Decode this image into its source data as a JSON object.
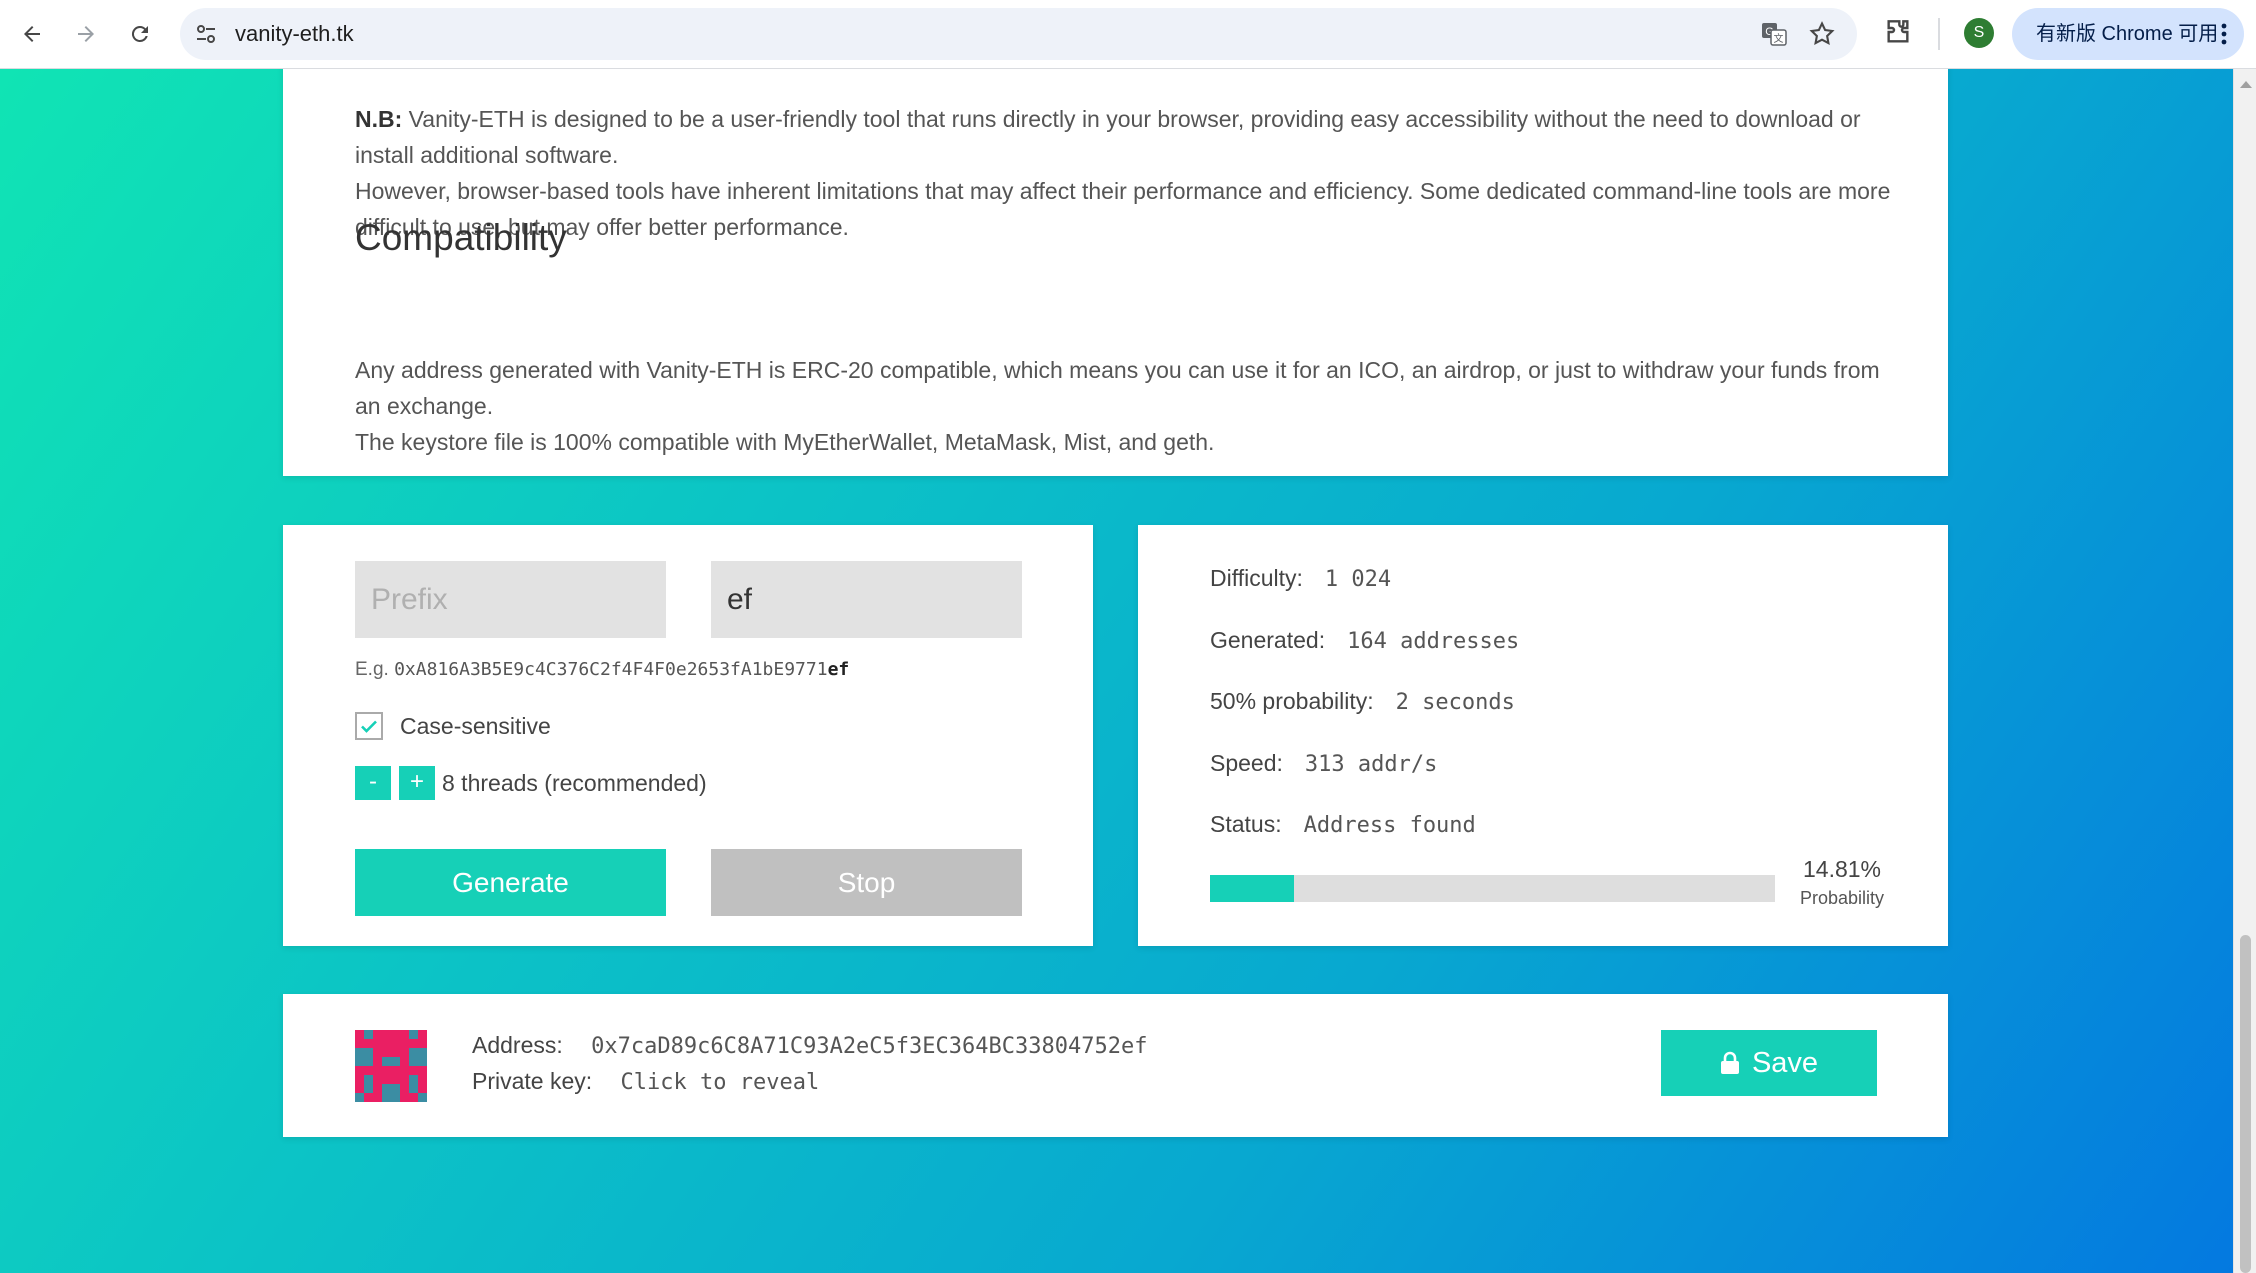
{
  "browser": {
    "url": "vanity-eth.tk",
    "profile_initial": "S",
    "update_label": "有新版 Chrome 可用"
  },
  "info": {
    "nb_bold": "N.B:",
    "nb_text": " Vanity-ETH is designed to be a user-friendly tool that runs directly in your browser, providing easy accessibility without the need to download or install additional software.",
    "limits_text": "However, browser-based tools have inherent limitations that may affect their performance and efficiency. Some dedicated command-line tools are more difficult to use, but may offer better performance.",
    "compat_heading": "Compatibility",
    "compat_text": "Any address generated with Vanity-ETH is ERC-20 compatible, which means you can use it for an ICO, an airdrop, or just to withdraw your funds from an exchange.",
    "keystore_text": "The keystore file is 100% compatible with MyEtherWallet, MetaMask, Mist, and geth."
  },
  "input": {
    "prefix_placeholder": "Prefix",
    "suffix_value": "ef",
    "example_label": "E.g.",
    "example_address": "0xA816A3B5E9c4C376C2f4F4F0e2653fA1bE9771",
    "example_suffix": "ef",
    "case_sensitive_label": "Case-sensitive",
    "case_sensitive_checked": true,
    "minus_label": "-",
    "plus_label": "+",
    "threads_label": "8 threads (recommended)",
    "generate_label": "Generate",
    "stop_label": "Stop"
  },
  "stats": {
    "difficulty_label": "Difficulty:",
    "difficulty_value": "1 024",
    "generated_label": "Generated:",
    "generated_value": "164 addresses",
    "probability50_label": "50% probability:",
    "probability50_value": "2 seconds",
    "speed_label": "Speed:",
    "speed_value": "313 addr/s",
    "status_label": "Status:",
    "status_value": "Address found",
    "probability_percent": "14.81%",
    "probability_fraction": 0.1481,
    "probability_label": "Probability"
  },
  "result": {
    "address_label": "Address:",
    "address_value": "0x7caD89c6C8A71C93A2eC5f3EC364BC33804752ef",
    "private_key_label": "Private key:",
    "private_key_value": "Click to reveal",
    "save_label": "Save"
  },
  "colors": {
    "accent": "#16d0b7",
    "stop_button": "#c0c0c0",
    "gradient_start": "#10e4b4",
    "gradient_end": "#0479e0",
    "identicon_pink": "#ea1f63",
    "identicon_teal": "#3b8da3"
  }
}
